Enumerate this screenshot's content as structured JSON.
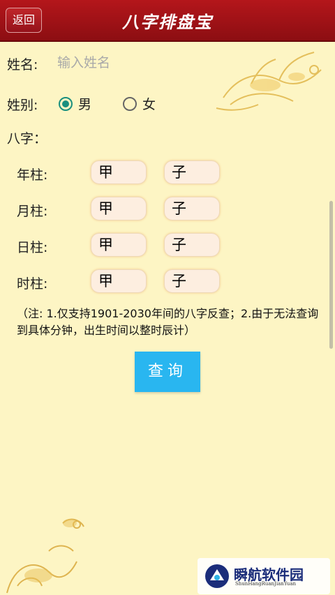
{
  "header": {
    "back_label": "返回",
    "title": "八字排盘宝"
  },
  "form": {
    "name_label": "姓名:",
    "name_placeholder": "输入姓名",
    "name_value": "",
    "gender_label": "姓别:",
    "gender_options": [
      {
        "label": "男",
        "checked": true
      },
      {
        "label": "女",
        "checked": false
      }
    ],
    "bazi_label": "八字："
  },
  "pillars": [
    {
      "label": "年柱:",
      "stem": "甲",
      "branch": "子"
    },
    {
      "label": "月柱:",
      "stem": "甲",
      "branch": "子"
    },
    {
      "label": "日柱:",
      "stem": "甲",
      "branch": "子"
    },
    {
      "label": "时柱:",
      "stem": "甲",
      "branch": "子"
    }
  ],
  "note": "（注: 1.仅支持1901-2030年间的八字反查；2.由于无法查询到具体分钟，出生时间以整时辰计）",
  "query_label": "查询",
  "watermark": {
    "text": "瞬航软件园",
    "sub": "ShunHangRuanJianYuan"
  },
  "colors": {
    "header_red": "#a3131a",
    "background": "#fdf5c4",
    "radio_accent": "#1a8f7e",
    "query_button": "#29b6f0"
  }
}
